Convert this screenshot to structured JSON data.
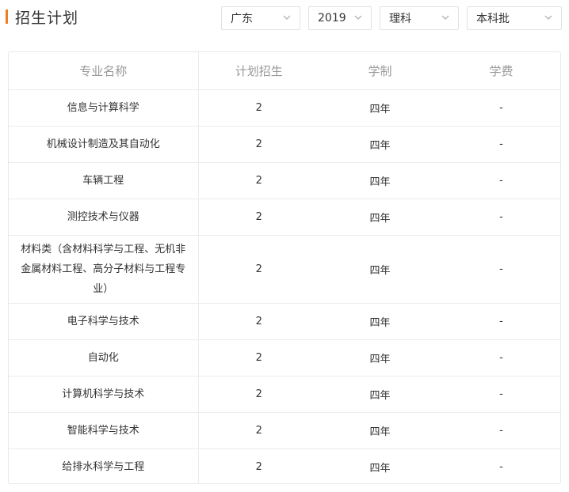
{
  "header": {
    "title": "招生计划",
    "accent_color": "#ef7d22"
  },
  "filters": {
    "province": "广东",
    "year": "2019",
    "subject": "理科",
    "batch": "本科批"
  },
  "table": {
    "columns": [
      "专业名称",
      "计划招生",
      "学制",
      "学费"
    ],
    "rows": [
      {
        "name": "信息与计算科学",
        "plan": "2",
        "duration": "四年",
        "fee": "-"
      },
      {
        "name": "机械设计制造及其自动化",
        "plan": "2",
        "duration": "四年",
        "fee": "-"
      },
      {
        "name": "车辆工程",
        "plan": "2",
        "duration": "四年",
        "fee": "-"
      },
      {
        "name": "测控技术与仪器",
        "plan": "2",
        "duration": "四年",
        "fee": "-"
      },
      {
        "name": "材料类（含材料科学与工程、无机非金属材料工程、高分子材料与工程专业）",
        "plan": "2",
        "duration": "四年",
        "fee": "-"
      },
      {
        "name": "电子科学与技术",
        "plan": "2",
        "duration": "四年",
        "fee": "-"
      },
      {
        "name": "自动化",
        "plan": "2",
        "duration": "四年",
        "fee": "-"
      },
      {
        "name": "计算机科学与技术",
        "plan": "2",
        "duration": "四年",
        "fee": "-"
      },
      {
        "name": "智能科学与技术",
        "plan": "2",
        "duration": "四年",
        "fee": "-"
      },
      {
        "name": "给排水科学与工程",
        "plan": "2",
        "duration": "四年",
        "fee": "-"
      }
    ]
  }
}
